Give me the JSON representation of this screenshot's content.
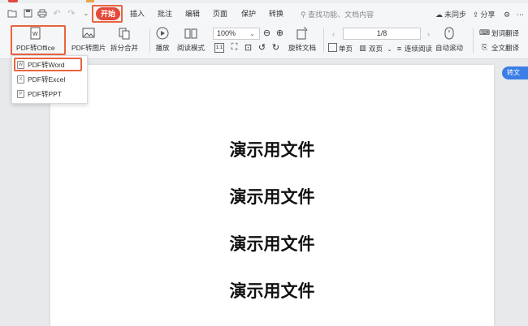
{
  "menubar": {
    "items": [
      "开始",
      "插入",
      "批注",
      "编辑",
      "页面",
      "保护",
      "转换"
    ],
    "search_placeholder": "查找功能、文档内容",
    "unsync": "未同步",
    "share": "分享"
  },
  "toolbar": {
    "pdf_to_office": "PDF转Office",
    "pdf_to_image": "PDF转图片",
    "split_merge": "拆分合并",
    "play": "播放",
    "read_mode": "阅读模式",
    "zoom": "100%",
    "rotate_doc": "旋转文档",
    "page_indicator": "1/8",
    "single_page": "单页",
    "double_page": "双页",
    "continuous_read": "连续阅读",
    "auto_scroll": "自动滚动",
    "word_translate": "划词翻译",
    "full_translate": "全文翻译"
  },
  "dropdown": {
    "items": [
      "PDF转Word",
      "PDF转Excel",
      "PDF转PPT"
    ]
  },
  "document": {
    "lines": [
      "演示用文件",
      "演示用文件",
      "演示用文件",
      "演示用文件"
    ]
  },
  "side_button": "转文",
  "colors": {
    "accent_red": "#e5493a",
    "highlight_orange": "#e9643f",
    "blue_button": "#3a7ee8"
  }
}
